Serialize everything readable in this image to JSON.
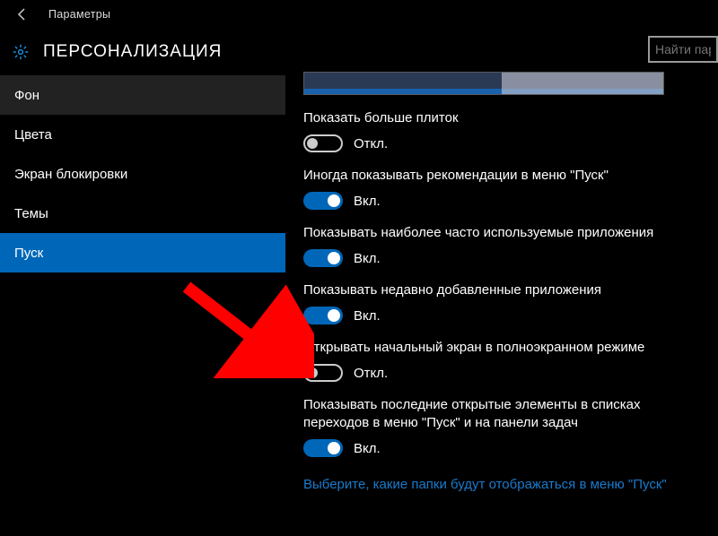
{
  "titlebar": {
    "title": "Параметры"
  },
  "header": {
    "page_heading": "ПЕРСОНАЛИЗАЦИЯ"
  },
  "search": {
    "placeholder": "Найти пара"
  },
  "sidebar": {
    "items": [
      {
        "label": "Фон",
        "selected": false,
        "hover": true
      },
      {
        "label": "Цвета",
        "selected": false,
        "hover": false
      },
      {
        "label": "Экран блокировки",
        "selected": false,
        "hover": false
      },
      {
        "label": "Темы",
        "selected": false,
        "hover": false
      },
      {
        "label": "Пуск",
        "selected": true,
        "hover": false
      }
    ]
  },
  "settings": [
    {
      "label": "Показать больше плиток",
      "state": "off",
      "state_text": "Откл."
    },
    {
      "label": "Иногда показывать рекомендации в меню \"Пуск\"",
      "state": "on",
      "state_text": "Вкл."
    },
    {
      "label": "Показывать наиболее часто используемые приложения",
      "state": "on",
      "state_text": "Вкл."
    },
    {
      "label": "Показывать недавно добавленные приложения",
      "state": "on",
      "state_text": "Вкл."
    },
    {
      "label": "Открывать начальный экран в полноэкранном режиме",
      "state": "off",
      "state_text": "Откл."
    },
    {
      "label": "Показывать последние открытые элементы в списках переходов в меню \"Пуск\" и на панели задач",
      "state": "on",
      "state_text": "Вкл."
    }
  ],
  "link": {
    "label": "Выберите, какие папки будут отображаться в меню \"Пуск\""
  },
  "annotation": {
    "arrow_color": "#ff0000"
  }
}
